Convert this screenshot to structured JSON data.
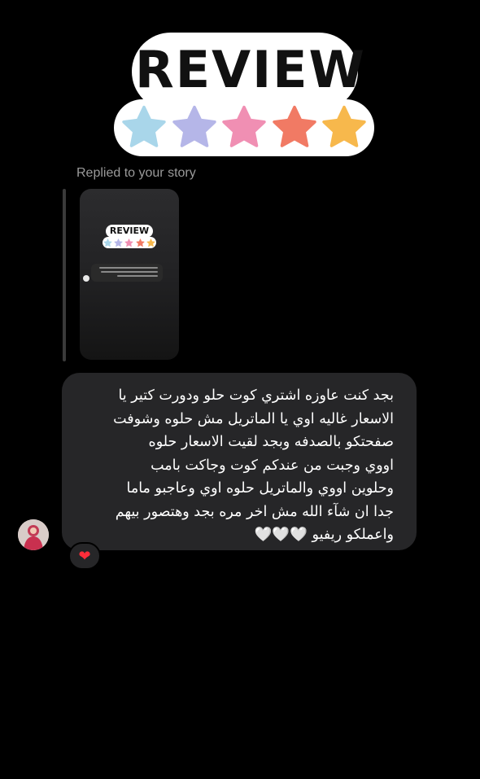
{
  "sticker": {
    "title": "REVIEW",
    "star_colors": [
      "#a9d6ea",
      "#b5b6e8",
      "#f08fb3",
      "#f17a64",
      "#f7b84c"
    ]
  },
  "reply": {
    "label": "Replied to your story"
  },
  "story_thumbnail": {
    "sticker_title": "REVIEW"
  },
  "message": {
    "text": "بجد كنت عاوزه اشتري كوت حلو ودورت كتير يا\nالاسعار غاليه اوي يا الماتريل مش حلوه وشوفت\nصفحتكو بالصدفه وبجد لقيت الاسعار حلوه\nاووي وجبت من عندكم كوت وجاكت بامب\nوحلوين اووي والماتريل حلوه اوي وعاجبو ماما\nجدا ان شآء الله مش اخر مره بجد وهتصور بيهم\nواعملكو ريفيو 🤍🤍🤍"
  },
  "reaction": {
    "emoji": "❤"
  },
  "colors": {
    "background": "#000000",
    "bubble": "#262628",
    "secondary_text": "#9a9a9a",
    "heart": "#ff2d3a"
  }
}
